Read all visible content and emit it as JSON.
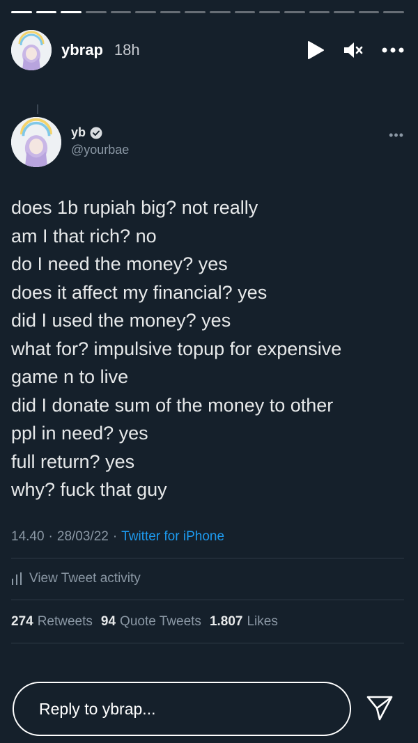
{
  "story": {
    "progress_segments": [
      true,
      true,
      true,
      false,
      false,
      false,
      false,
      false,
      false,
      false,
      false,
      false,
      false,
      false,
      false,
      false
    ],
    "username": "ybrap",
    "time": "18h",
    "avatar_icon": "avatar-cartoon-icon",
    "controls": [
      "play-icon",
      "mute-icon",
      "more-icon"
    ]
  },
  "tweet": {
    "display_name": "yb",
    "verified_icon": "verified-badge-icon",
    "handle": "@yourbae",
    "lines": [
      "does 1b rupiah big? not really",
      "am I that rich? no",
      "do I need the money? yes",
      "does it affect my financial? yes",
      "did I used the money? yes",
      "what for? impulsive topup for expensive",
      "game n to live",
      "did I donate sum of the money to other",
      "ppl in need? yes",
      "full return? yes",
      "why? fuck that guy"
    ],
    "time": "14.40",
    "date": "28/03/22",
    "source": "Twitter for iPhone",
    "activity": "View Tweet activity",
    "retweets": "274",
    "retweets_label": "Retweets",
    "quotes": "94",
    "quotes_label": "Quote Tweets",
    "likes": "1.807",
    "likes_label": "Likes"
  },
  "reply": {
    "placeholder": "Reply to ybrap..."
  },
  "colors": {
    "background": "#15202b",
    "accent": "#1d9bf0",
    "secondary_text": "#8b98a5"
  }
}
